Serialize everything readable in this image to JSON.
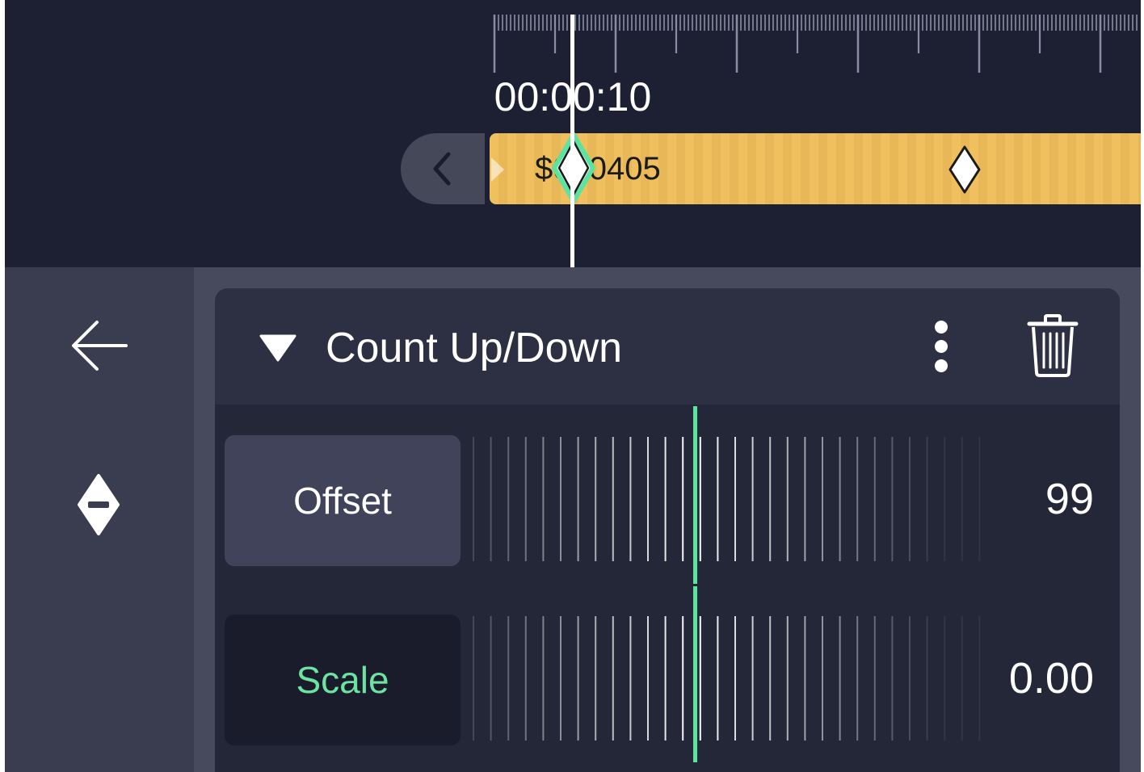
{
  "timeline": {
    "timecode": "00:00:10",
    "clip": {
      "label": "$000405"
    }
  },
  "effect": {
    "title": "Count Up/Down",
    "properties": [
      {
        "label": "Offset",
        "value": "99"
      },
      {
        "label": "Scale",
        "value": "0.00"
      }
    ]
  },
  "colors": {
    "timeline_bg": "#1d2033",
    "clip": "#f0c05e",
    "accent_green": "#5de3a0",
    "panel_bg": "#474a5c",
    "card_bg": "#242738"
  },
  "icons": [
    "chevron-left-icon",
    "keyframe-diamond-icon",
    "arrow-left-icon",
    "keyframe-remove-icon",
    "triangle-down-icon",
    "more-vertical-icon",
    "trash-icon"
  ]
}
